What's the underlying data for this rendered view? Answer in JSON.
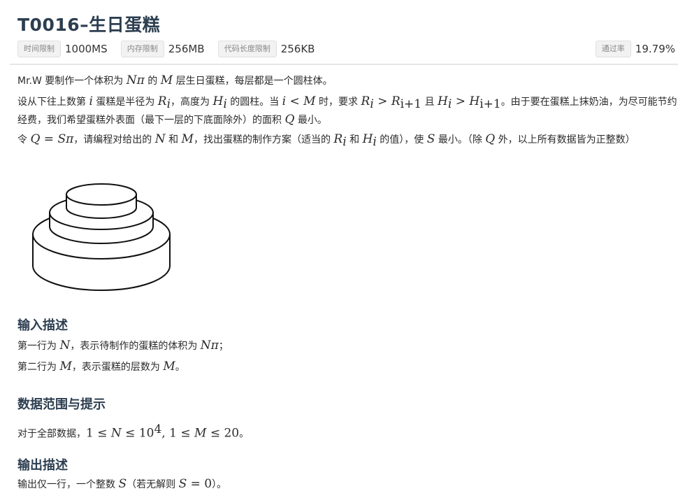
{
  "problem": {
    "title": "T0016–生日蛋糕"
  },
  "limits": {
    "time_label": "时间限制",
    "time_value": "1000MS",
    "memory_label": "内存限制",
    "memory_value": "256MB",
    "code_label": "代码长度限制",
    "code_value": "256KB",
    "pass_label": "通过率",
    "pass_value": "19.79%"
  },
  "description": {
    "p1": {
      "a": "Mr.W 要制作一个体积为 ",
      "nm": "N",
      "pi": "π",
      "b": " 的 ",
      "m": "M",
      "c": " 层生日蛋糕，每层都是一个圆柱体。"
    },
    "p2": {
      "a": "设从下往上数第 ",
      "i": "i",
      "b": " 蛋糕是半径为 ",
      "r": "R",
      "ri": "i",
      "c": "，高度为 ",
      "h": "H",
      "hi": "i",
      "d": " 的圆柱。当 ",
      "i2": "i",
      "lt": " < ",
      "m2": "M",
      "e": " 时，要求 ",
      "r2": "R",
      "r2i": "i",
      "gt1": " > ",
      "r3": "R",
      "r3i": "i+1",
      "f": " 且 ",
      "h2": "H",
      "h2i": "i",
      "gt2": " > ",
      "h3": "H",
      "h3i": "i+1",
      "g": "。由于要在蛋糕上抹奶油，为尽可能节约经费，我们希望蛋糕外表面（最下一层的下底面除外）的面积 ",
      "q": "Q",
      "h_end": " 最小。"
    },
    "p3": {
      "a": "令 ",
      "q": "Q",
      "eq": " = ",
      "s": "S",
      "pi": "π",
      "b": "，请编程对给出的 ",
      "n": "N",
      "c": " 和 ",
      "m": "M",
      "d": "，找出蛋糕的制作方案（适当的 ",
      "r": "R",
      "ri": "i",
      "e": " 和 ",
      "h": "H",
      "hi": "i",
      "f": " 的值），使 ",
      "s2": "S",
      "g": " 最小。（除 ",
      "q2": "Q",
      "h_end": " 外，以上所有数据皆为正整数）"
    }
  },
  "input": {
    "heading": "输入描述",
    "l1": {
      "a": "第一行为 ",
      "n": "N",
      "b": "，表示待制作的蛋糕的体积为 ",
      "n2": "N",
      "pi": "π",
      "c": "；"
    },
    "l2": {
      "a": "第二行为 ",
      "m": "M",
      "b": "，表示蛋糕的层数为 ",
      "m2": "M",
      "c": "。"
    }
  },
  "range": {
    "heading": "数据范围与提示",
    "a": "对于全部数据，",
    "one1": "1",
    "le1": " ≤ ",
    "n": "N",
    "le2": " ≤ ",
    "ten": "10",
    "exp": "4",
    "comma": ", ",
    "one2": "1",
    "le3": " ≤ ",
    "m": "M",
    "le4": " ≤ ",
    "twenty": "20",
    "b": "。"
  },
  "output": {
    "heading": "输出描述",
    "a": "输出仅一行，一个整数 ",
    "s": "S",
    "b": "（若无解则 ",
    "s2": "S",
    "eq": " = ",
    "zero": "0",
    "c": "）。"
  }
}
